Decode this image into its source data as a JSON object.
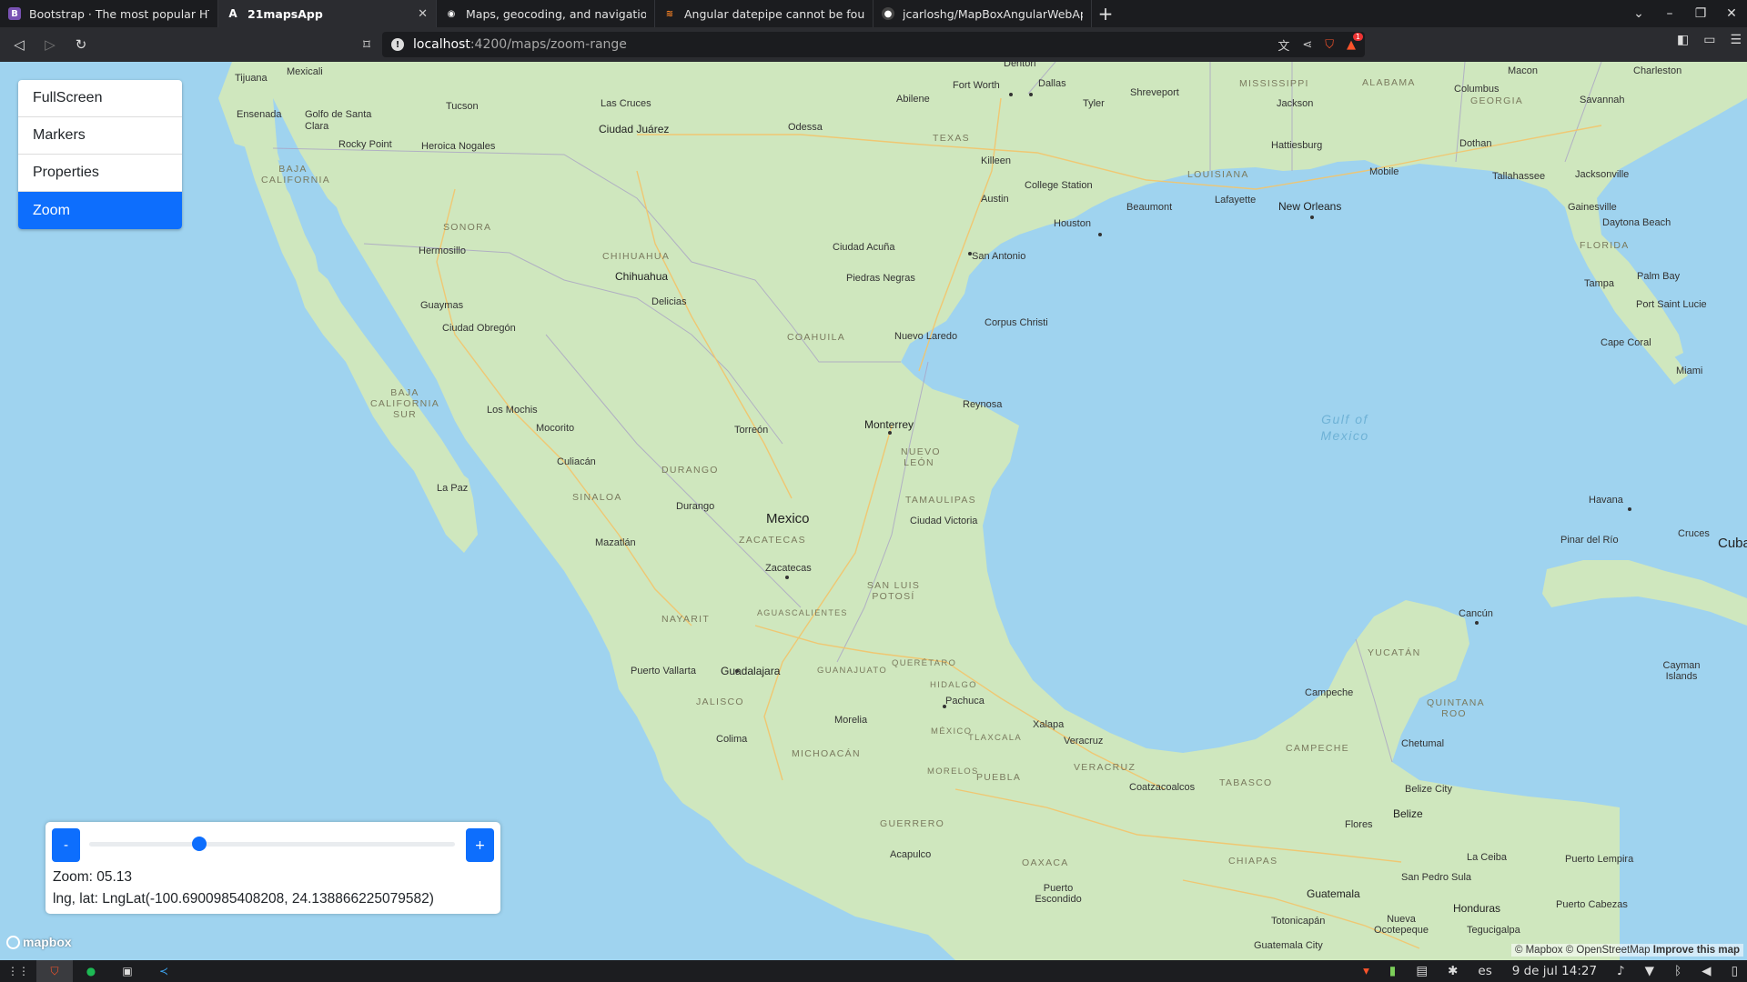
{
  "browser": {
    "tabs": [
      {
        "title": "Bootstrap · The most popular HTML,",
        "icon": "bootstrap-icon",
        "color": "#7952b3"
      },
      {
        "title": "21mapsApp",
        "icon": "angular-icon",
        "color": "#dd0031"
      },
      {
        "title": "Maps, geocoding, and navigation API",
        "icon": "mapbox-icon",
        "color": "#ffffff"
      },
      {
        "title": "Angular datepipe cannot be found -",
        "icon": "stackoverflow-icon",
        "color": "#f48024"
      },
      {
        "title": "jcarloshg/MapBoxAngularWebApp",
        "icon": "github-icon",
        "color": "#ffffff"
      }
    ],
    "url_host": "localhost",
    "url_path": ":4200/maps/zoom-range",
    "brave_badge": "1"
  },
  "menu": {
    "items": [
      "FullScreen",
      "Markers",
      "Properties",
      "Zoom"
    ],
    "active": "Zoom",
    "accent": "#0d6efd"
  },
  "zoom": {
    "minus": "-",
    "plus": "+",
    "text": "Zoom: 05.13",
    "lnglat": "lng, lat: LngLat(-100.6900985408208, 24.138866225079582)",
    "slider_fraction": 0.3
  },
  "map": {
    "labels": {
      "tijuana": "Tijuana",
      "mexicali": "Mexicali",
      "ensenada": "Ensenada",
      "golfo": "Golfo de Santa Clara",
      "rocky": "Rocky Point",
      "tucson": "Tucson",
      "heroica": "Heroica Nogales",
      "lascruces": "Las Cruces",
      "juarez": "Ciudad Juárez",
      "odessa": "Odessa",
      "abilene": "Abilene",
      "fortworth": "Fort Worth",
      "dallas": "Dallas",
      "denton": "Denton",
      "tyler": "Tyler",
      "shreveport": "Shreveport",
      "texas": "TEXAS",
      "killeen": "Killeen",
      "austin": "Austin",
      "collegestation": "College Station",
      "houston": "Houston",
      "beaumont": "Beaumont",
      "lafayette": "Lafayette",
      "neworleans": "New Orleans",
      "sanantonio": "San Antonio",
      "louisiana": "LOUISIANA",
      "mississippi": "MISSISSIPPI",
      "alabama": "ALABAMA",
      "jackson": "Jackson",
      "hattiesburg": "Hattiesburg",
      "mobile": "Mobile",
      "dothan": "Dothan",
      "columbus": "Columbus",
      "georgia": "GEORGIA",
      "macon": "Macon",
      "savannah": "Savannah",
      "charleston": "Charleston",
      "tallahassee": "Tallahassee",
      "jacksonville": "Jacksonville",
      "gainesville": "Gainesville",
      "daytona": "Daytona Beach",
      "florida": "FLORIDA",
      "tampa": "Tampa",
      "palmbay": "Palm Bay",
      "portstlucie": "Port Saint Lucie",
      "capecoral": "Cape Coral",
      "miami": "Miami",
      "bajacal": "BAJA CALIFORNIA",
      "sonora": "SONORA",
      "hermosillo": "Hermosillo",
      "guaymas": "Guaymas",
      "obregon": "Ciudad Obregón",
      "chihuahuast": "CHIHUAHUA",
      "chihuahua": "Chihuahua",
      "delicias": "Delicias",
      "acuna": "Ciudad Acuña",
      "piedras": "Piedras Negras",
      "coahuila": "COAHUILA",
      "nuevolaredo": "Nuevo Laredo",
      "corpus": "Corpus Christi",
      "reynosa": "Reynosa",
      "monterrey": "Monterrey",
      "nuevoleon": "NUEVO LEÓN",
      "torreon": "Torreón",
      "losmochis": "Los Mochis",
      "mocorito": "Mocorito",
      "culiacan": "Culiacán",
      "bajasur": "BAJA CALIFORNIA SUR",
      "lapaz": "La Paz",
      "sinaloa": "SINALOA",
      "durangost": "DURANGO",
      "durango": "Durango",
      "mexico": "Mexico",
      "tamaulipas": "TAMAULIPAS",
      "victoria": "Ciudad Victoria",
      "zacatecasst": "ZACATECAS",
      "zacatecas": "Zacatecas",
      "mazatlan": "Mazatlán",
      "sanluis": "SAN LUIS POTOSÍ",
      "nayarit": "NAYARIT",
      "aguascalientes": "AGUASCALIENTES",
      "vallarta": "Puerto Vallarta",
      "guadalajara": "Guadalajara",
      "guanajuato": "GUANAJUATO",
      "queretaro": "QUERÉTARO",
      "hidalgo": "HIDALGO",
      "pachuca": "Pachuca",
      "jalisco": "JALISCO",
      "morelia": "Morelia",
      "colima": "Colima",
      "michoacan": "MICHOACÁN",
      "mexicost": "MÉXICO",
      "tlaxcala": "TLAXCALA",
      "xalapa": "Xalapa",
      "veracruz": "Veracruz",
      "veracruzst": "VERACRUZ",
      "morelos": "MORELOS",
      "puebla": "PUEBLA",
      "guerrero": "GUERRERO",
      "acapulco": "Acapulco",
      "oaxaca": "OAXACA",
      "escondido": "Puerto Escondido",
      "coatzacoalcos": "Coatzacoalcos",
      "tabasco": "TABASCO",
      "chiapas": "CHIAPAS",
      "campeche": "Campeche",
      "campechest": "CAMPECHE",
      "yucatan": "YUCATÁN",
      "quintana": "QUINTANA ROO",
      "cancun": "Cancún",
      "chetumal": "Chetumal",
      "belizecity": "Belize City",
      "belize": "Belize",
      "flores": "Flores",
      "laceiba": "La Ceiba",
      "puertolempira": "Puerto Lempira",
      "sanpedro": "San Pedro Sula",
      "puertocabezas": "Puerto Cabezas",
      "guatemala": "Guatemala",
      "honduras": "Honduras",
      "tegucigalpa": "Tegucigalpa",
      "totonicapan": "Totonicapán",
      "nuevaocotepeque": "Nueva Ocotepeque",
      "guatemalacity": "Guatemala City",
      "havana": "Havana",
      "pinar": "Pinar del Río",
      "cruces": "Cruces",
      "cuba": "Cuba",
      "cayman": "Cayman Islands",
      "gulf": "Gulf of Mexico"
    },
    "mapbox_logo": "mapbox",
    "attribution": "© Mapbox © OpenStreetMap",
    "improve": "Improve this map"
  },
  "taskbar": {
    "lang": "es",
    "date": "9 de jul",
    "time": "14:27"
  }
}
